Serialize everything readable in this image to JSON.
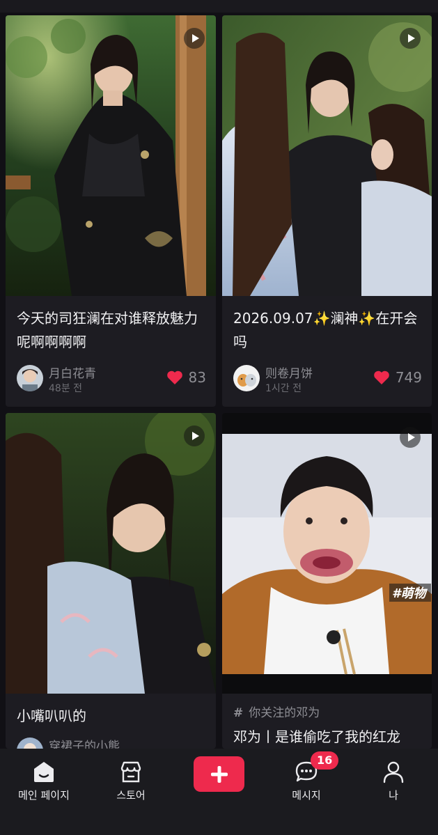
{
  "feed": [
    {
      "title": "今天的司狂澜在对谁释放魅力呢啊啊啊啊",
      "author": "月白花青",
      "time": "48분 전",
      "likes": "83"
    },
    {
      "title": "2026.09.07✨澜神✨在开会吗",
      "author": "则卷月饼",
      "time": "1시간 전",
      "likes": "749"
    },
    {
      "title": "小嘴叭叭的",
      "author": "穿裙子的小熊",
      "time": "",
      "likes": ""
    },
    {
      "topic": "你关注的邓为",
      "title": "邓为丨是谁偷吃了我的红龙",
      "overlay_tag": "#萌物"
    }
  ],
  "colors": {
    "accent": "#ee2a4d",
    "card_bg": "#1d1c22",
    "page_bg": "#111015"
  },
  "tabbar": {
    "items": [
      {
        "label": "메인 페이지",
        "icon": "home-icon"
      },
      {
        "label": "스토어",
        "icon": "store-icon"
      },
      {
        "label": "",
        "icon": "plus-icon"
      },
      {
        "label": "메시지",
        "icon": "message-icon",
        "badge": "16"
      },
      {
        "label": "나",
        "icon": "profile-icon"
      }
    ]
  }
}
